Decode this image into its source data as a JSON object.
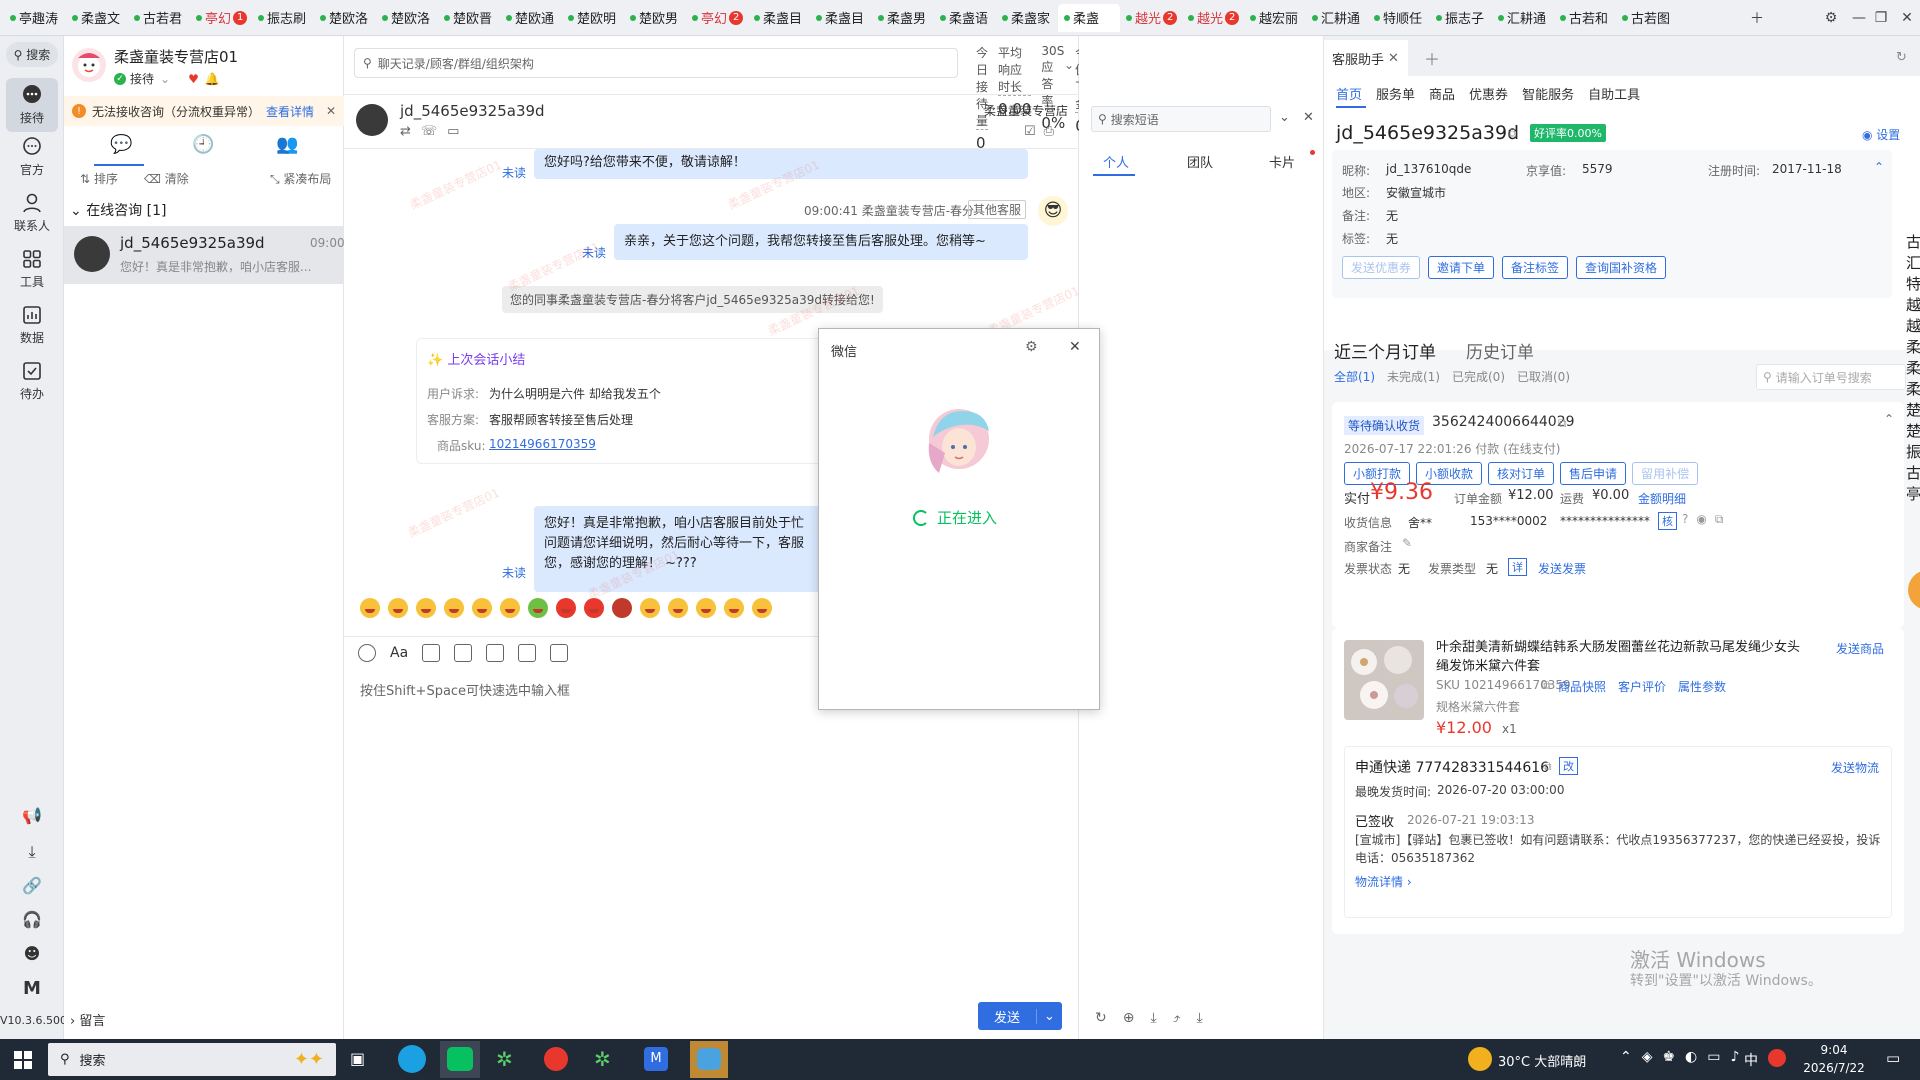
{
  "tabs": [
    {
      "label": "亭趣涛",
      "badge": "",
      "red": false
    },
    {
      "label": "柔盏文",
      "badge": "",
      "red": false
    },
    {
      "label": "古若君",
      "badge": "",
      "red": false
    },
    {
      "label": "亭幻",
      "badge": "1",
      "red": true
    },
    {
      "label": "振志刷",
      "badge": "",
      "red": false
    },
    {
      "label": "楚欧洛",
      "badge": "",
      "red": false
    },
    {
      "label": "楚欧洛",
      "badge": "",
      "red": false
    },
    {
      "label": "楚欧晋",
      "badge": "",
      "red": false
    },
    {
      "label": "楚欧通",
      "badge": "",
      "red": false
    },
    {
      "label": "楚欧明",
      "badge": "",
      "red": false
    },
    {
      "label": "楚欧男",
      "badge": "",
      "red": false
    },
    {
      "label": "亭幻",
      "badge": "2",
      "red": true
    },
    {
      "label": "柔盏目",
      "badge": "",
      "red": false
    },
    {
      "label": "柔盏目",
      "badge": "",
      "red": false
    },
    {
      "label": "柔盏男",
      "badge": "",
      "red": false
    },
    {
      "label": "柔盏语",
      "badge": "",
      "red": false
    },
    {
      "label": "柔盏家",
      "badge": "",
      "red": false
    },
    {
      "label": "柔盏",
      "badge": "",
      "red": false,
      "active": true
    },
    {
      "label": "越光",
      "badge": "2",
      "red": true
    },
    {
      "label": "越光",
      "badge": "2",
      "red": true
    },
    {
      "label": "越宏丽",
      "badge": "",
      "red": false
    },
    {
      "label": "汇耕通",
      "badge": "",
      "red": false
    },
    {
      "label": "特顺任",
      "badge": "",
      "red": false
    },
    {
      "label": "振志子",
      "badge": "",
      "red": false
    },
    {
      "label": "汇耕通",
      "badge": "",
      "red": false
    },
    {
      "label": "古若和",
      "badge": "",
      "red": false
    },
    {
      "label": "古若图",
      "badge": "",
      "red": false
    }
  ],
  "rail": {
    "search": "搜索",
    "reception": "接待",
    "official": "官方",
    "contacts": "联系人",
    "tools": "工具",
    "data": "数据",
    "todo": "待办",
    "version": "V10.3.6.500"
  },
  "store": {
    "name": "柔盏童装专营店01",
    "status": "接待"
  },
  "warning": {
    "text": "无法接收咨询（分流权重异常）",
    "link": "查看详情"
  },
  "contacts_toolbar": {
    "sort": "排序",
    "clear": "清除",
    "compact": "紧凑布局"
  },
  "online": {
    "header": "在线咨询 [1]",
    "item": {
      "name": "jd_5465e9325a39d",
      "time": "09:00",
      "preview": "您好！真是非常抱歉，咱小店客服..."
    }
  },
  "leave_msg": "留言",
  "chat": {
    "search_placeholder": "聊天记录/顾客/群组/组织架构",
    "stats": [
      {
        "label": "今日接待量",
        "value": "0"
      },
      {
        "label": "平均响应时长",
        "value": "0.00"
      },
      {
        "label": "30S应答率",
        "value": "0%"
      },
      {
        "label": "今日促成下单金额",
        "value": "0.00"
      }
    ],
    "customer": "jd_5465e9325a39d",
    "shop_label": "柔盏童装专营店",
    "msg1": "您好吗?给您带来不便，敬请谅解！",
    "unread": "未读",
    "msg2_meta": "09:00:41 柔盏童装专营店-春分",
    "msg2_tag": "其他客服",
    "msg2": "亲亲，关于您这个问题，我帮您转接至售后客服处理。您稍等~",
    "transfer": "您的同事柔盏童装专营店-春分将客户jd_5465e9325a39d转接给您!",
    "summary": {
      "title": "上次会话小结",
      "complaint_label": "用户诉求:",
      "complaint": "为什么明明是六件 却给我发五个",
      "plan_label": "客服方案:",
      "plan": "客服帮顾客转接至售后处理",
      "sku_label": "商品sku:",
      "sku": "10214966170359"
    },
    "msg3": "您好！真是非常抱歉，咱小店客服目前处于忙\n问题请您详细说明，然后耐心等待一下，客服\n您，感谢您的理解！ ~???",
    "input_hint": "按住Shift+Space可快速选中输入框",
    "send": "发送",
    "watermark": "柔盏童装专营店01"
  },
  "shortcuts": {
    "search_placeholder": "搜索短语",
    "tabs": [
      "个人",
      "团队",
      "卡片"
    ]
  },
  "dialog": {
    "title": "微信",
    "status": "正在进入"
  },
  "assistant": {
    "tab": "客服助手",
    "nav": [
      "首页",
      "服务单",
      "商品",
      "优惠券",
      "智能服务",
      "自助工具"
    ],
    "customer": "jd_5465e9325a39d",
    "rating": "好评率0.00%",
    "settings": "设置",
    "nickname_label": "昵称:",
    "nickname": "jd_137610qde",
    "jxz_label": "京享值:",
    "jxz": "5579",
    "reg_label": "注册时间:",
    "reg": "2017-11-18",
    "region_label": "地区:",
    "region": "安徽宣城市",
    "note_label": "备注:",
    "note": "无",
    "tag_label": "标签:",
    "tag": "无",
    "actions": [
      "发送优惠券",
      "邀请下单",
      "备注标签",
      "查询国补资格"
    ],
    "orders_title": "近三个月订单",
    "history": "历史订单",
    "filters": [
      "全部(1)",
      "未完成(1)",
      "已完成(0)",
      "已取消(0)"
    ],
    "order_search": "请输入订单号搜索",
    "order": {
      "status": "等待确认收货",
      "id": "3562424006644029",
      "time": "2026-07-17 22:01:26 付款 (在线支付)",
      "btns": [
        "小额打款",
        "小额收款",
        "核对订单",
        "售后申请",
        "留用补偿"
      ],
      "paid_label": "实付",
      "paid": "¥9.36",
      "amount_label": "订单金额",
      "amount": "¥12.00",
      "ship_label": "运费",
      "ship": "¥0.00",
      "detail": "金额明细",
      "recv_label": "收货信息",
      "recv_name": "舍**",
      "recv_phone": "153****0002",
      "recv_addr": "***************",
      "recv_tag": "核",
      "remark_label": "商家备注",
      "invoice_status_label": "发票状态",
      "invoice_status": "无",
      "invoice_type_label": "发票类型",
      "invoice_type": "无",
      "invoice_tag": "详",
      "send_invoice": "发送发票"
    },
    "product": {
      "title": "叶余甜美清新蝴蝶结韩系大肠发圈蕾丝花边新款马尾发绳少女头绳发饰米黛六件套",
      "sku": "SKU 10214966170359",
      "snapshot": "商品快照",
      "review": "客户评价",
      "params": "属性参数",
      "spec": "规格米黛六件套",
      "price": "¥12.00",
      "qty": "x1",
      "send": "发送商品"
    },
    "logistics": {
      "title": "申通快递 777428331544616",
      "tag": "改",
      "send": "发送物流",
      "latest_label": "最晚发货时间:",
      "latest": "2026-07-20 03:00:00",
      "signed": "已签收",
      "signed_time": "2026-07-21 19:03:13",
      "desc": "[宣城市]【驿站】包裹已签收！如有问题请联系：代收点19356377237，您的快递已经妥投，投诉电话：05635187362",
      "more": "物流详情"
    },
    "side_chars": [
      "古",
      "汇",
      "特",
      "越",
      "越",
      "柔",
      "柔",
      "柔",
      "楚",
      "楚",
      "振",
      "古",
      "亭"
    ]
  },
  "activation": {
    "line1": "激活 Windows",
    "line2": "转到\"设置\"以激活 Windows。"
  },
  "taskbar": {
    "search": "搜索",
    "weather": "30°C 大部晴朗",
    "time": "9:04",
    "date": "2026/7/22",
    "ime": "中"
  }
}
